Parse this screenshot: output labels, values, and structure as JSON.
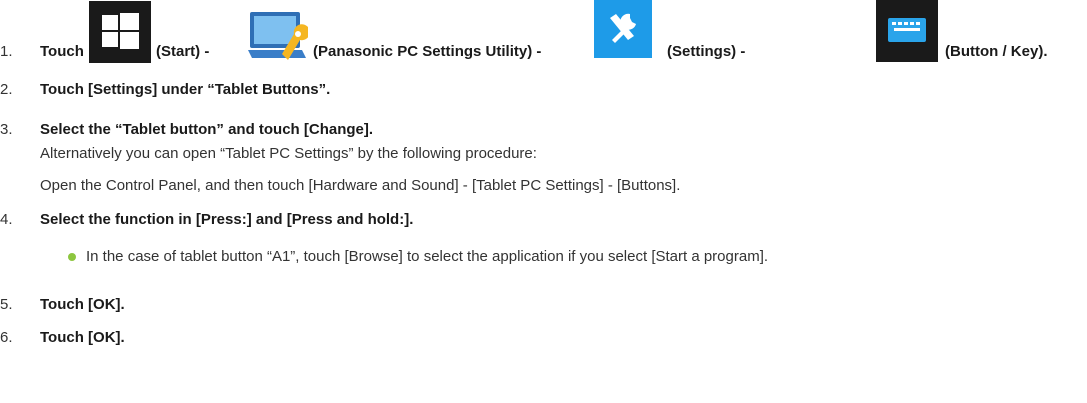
{
  "steps": [
    {
      "num": "1.",
      "parts": [
        "Touch",
        "(Start) -",
        "(Panasonic PC Settings Utility) -",
        "(Settings) -",
        "(Button / Key)."
      ]
    },
    {
      "num": "2.",
      "text": "Touch [Settings] under “Tablet Buttons”."
    },
    {
      "num": "3.",
      "text": "Select the “Tablet button” and touch [Change].",
      "notes": [
        "Alternatively you can open “Tablet PC Settings” by the following procedure:",
        "Open the Control Panel, and then touch [Hardware and Sound] - [Tablet PC Settings] - [Buttons]."
      ]
    },
    {
      "num": "4.",
      "text": "Select the function in [Press:] and [Press and hold:].",
      "bullet": "In the case of tablet button “A1”, touch [Browse] to select the application if you select [Start a program]."
    },
    {
      "num": "5.",
      "text": "Touch [OK]."
    },
    {
      "num": "6.",
      "text": "Touch [OK]."
    }
  ],
  "icons": [
    "windows-start-icon",
    "panasonic-pc-settings-utility-icon",
    "settings-tools-icon",
    "button-key-icon"
  ]
}
